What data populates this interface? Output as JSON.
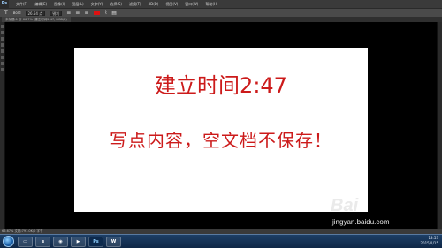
{
  "app": {
    "logo": "Ps"
  },
  "menu": {
    "items": [
      "文件(F)",
      "编辑(E)",
      "图像(I)",
      "图层(L)",
      "文字(Y)",
      "选择(S)",
      "滤镜(T)",
      "3D(D)",
      "视图(V)",
      "窗口(W)",
      "帮助(H)"
    ]
  },
  "options": {
    "tool_glyph": "T",
    "font_style": "Bold",
    "font_size": "26.54 点",
    "anti_alias": "锐利",
    "accent_color": "#dd1111"
  },
  "document": {
    "tab_label": "未标题-1 @ 66.7% (建立时间2:47, RGB/8)",
    "title_text": "建立时间2:47",
    "note_text": "写点内容，空文档不保存！",
    "text_color": "#cc1a1a"
  },
  "status": {
    "zoom_text": "66.67%   文档:791.0K/0 字节"
  },
  "taskbar": {
    "icons": [
      "folder",
      "e",
      "chrome",
      "media",
      "Ps",
      "word"
    ],
    "clock_time": "13:53",
    "clock_date": "2015/1/15"
  },
  "watermark": {
    "main": "Bai",
    "sub": "jingyan.baidu.com"
  }
}
